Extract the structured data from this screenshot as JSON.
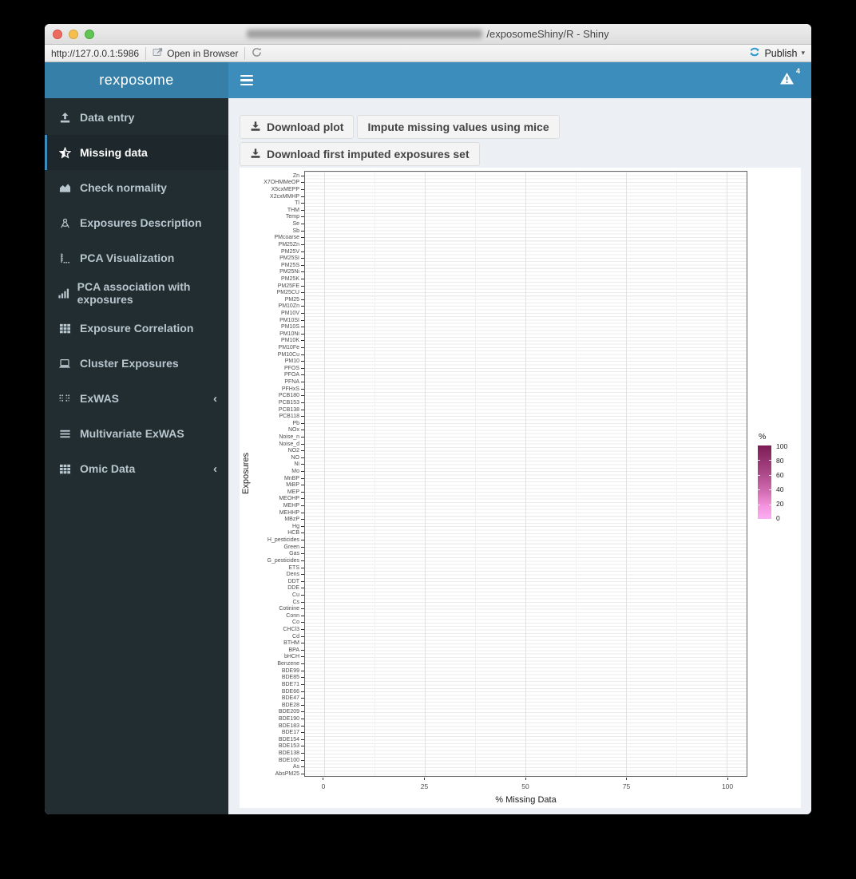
{
  "window": {
    "title_suffix": "/exposomeShiny/R - Shiny",
    "traffic_lights": [
      "close",
      "minimize",
      "zoom"
    ]
  },
  "browser_bar": {
    "url": "http://127.0.0.1:5986",
    "open_in_browser_label": "Open in Browser",
    "open_in_browser_icon": "open-in-browser-icon",
    "refresh_icon": "refresh-icon",
    "publish_label": "Publish",
    "publish_icon": "publish-icon",
    "publish_caret": "▾",
    "accent_color": "#2798d2"
  },
  "header": {
    "logo": "rexposome",
    "logo_bg": "#367fa9",
    "navbar_bg": "#3c8dbc",
    "menu_icon": "hamburger-icon",
    "alert_icon": "warning-triangle-icon",
    "alert_count": "4"
  },
  "sidebar": {
    "bg": "#222d32",
    "active_bg": "#1e282c",
    "active_border": "#3c8dbc",
    "text_color": "#b8c7ce",
    "items": [
      {
        "label": "Data entry",
        "icon": "upload-icon",
        "active": false,
        "chevron": false
      },
      {
        "label": "Missing data",
        "icon": "star-half-icon",
        "active": true,
        "chevron": false
      },
      {
        "label": "Check normality",
        "icon": "area-chart-icon",
        "active": false,
        "chevron": false
      },
      {
        "label": "Exposures Description",
        "icon": "drafting-compass-icon",
        "active": false,
        "chevron": false
      },
      {
        "label": "PCA Visualization",
        "icon": "ruler-chart-icon",
        "active": false,
        "chevron": false
      },
      {
        "label": "PCA association with exposures",
        "icon": "bar-chart-icon",
        "active": false,
        "chevron": false
      },
      {
        "label": "Exposure Correlation",
        "icon": "grid-icon",
        "active": false,
        "chevron": false
      },
      {
        "label": "Cluster Exposures",
        "icon": "laptop-icon",
        "active": false,
        "chevron": false
      },
      {
        "label": "ExWAS",
        "icon": "braille-icon",
        "active": false,
        "chevron": true
      },
      {
        "label": "Multivariate ExWAS",
        "icon": "list-lines-icon",
        "active": false,
        "chevron": false
      },
      {
        "label": "Omic Data",
        "icon": "grid-icon",
        "active": false,
        "chevron": true
      }
    ]
  },
  "toolbar": {
    "download_plot_label": "Download plot",
    "download_plot_icon": "download-icon",
    "impute_label": "Impute missing values using mice",
    "download_imputed_label": "Download first imputed exposures set",
    "download_imputed_icon": "download-icon"
  },
  "chart_data": {
    "type": "bar",
    "orientation": "horizontal",
    "title": "",
    "xlabel": "% Missing Data",
    "ylabel": "Exposures",
    "xlim": [
      0,
      100
    ],
    "x_ticks": [
      0,
      25,
      50,
      75,
      100
    ],
    "x_minor_ticks": [
      12.5,
      37.5,
      62.5,
      87.5
    ],
    "grid": true,
    "categories": [
      "Zn",
      "X7OHMMeOP",
      "X5cxMEPP",
      "X2cxMMHP",
      "Tl",
      "THM",
      "Temp",
      "Se",
      "Sb",
      "PMcoarse",
      "PM25Zn",
      "PM25V",
      "PM25SI",
      "PM25S",
      "PM25Ni",
      "PM25K",
      "PM25FE",
      "PM25CU",
      "PM25",
      "PM10Zn",
      "PM10V",
      "PM10SI",
      "PM10S",
      "PM10Ni",
      "PM10K",
      "PM10Fe",
      "PM10Cu",
      "PM10",
      "PFOS",
      "PFOA",
      "PFNA",
      "PFHxS",
      "PCB180",
      "PCB153",
      "PCB138",
      "PCB118",
      "Pb",
      "NOx",
      "Noise_n",
      "Noise_d",
      "NO2",
      "NO",
      "Ni",
      "Mo",
      "MnBP",
      "MiBP",
      "MEP",
      "MEOHP",
      "MEHP",
      "MEHHP",
      "MBzP",
      "Hg",
      "HCB",
      "H_pesticides",
      "Green",
      "Gas",
      "G_pesticides",
      "ETS",
      "Dens",
      "DDT",
      "DDE",
      "Cu",
      "Cs",
      "Cotinine",
      "Conn",
      "Co",
      "CHCl3",
      "Cd",
      "BTHM",
      "BPA",
      "bHCH",
      "Benzene",
      "BDE99",
      "BDE85",
      "BDE71",
      "BDE66",
      "BDE47",
      "BDE28",
      "BDE209",
      "BDE190",
      "BDE183",
      "BDE17",
      "BDE154",
      "BDE153",
      "BDE138",
      "BDE100",
      "As",
      "AbsPM25"
    ],
    "values": [
      0,
      0,
      0,
      0,
      0,
      0,
      0,
      0,
      0,
      0,
      0,
      0,
      0,
      0,
      0,
      0,
      0,
      0,
      0,
      0,
      0,
      0,
      0,
      0,
      0,
      0,
      0,
      0,
      0,
      0,
      0,
      0,
      0,
      0,
      0,
      0,
      0,
      0,
      0,
      0,
      0,
      0,
      0,
      0,
      0,
      0,
      0,
      0,
      0,
      0,
      0,
      0,
      0,
      0,
      0,
      0,
      0,
      0,
      0,
      0,
      0,
      0,
      0,
      0,
      0,
      0,
      0,
      0,
      0,
      0,
      0,
      0,
      0,
      0,
      0,
      0,
      0,
      0,
      0,
      0,
      0,
      0,
      0,
      0,
      0,
      0,
      0,
      0
    ],
    "bar_color": "#fcaff2",
    "legend": {
      "title": "%",
      "position": "right",
      "tick_labels": [
        "100",
        "80",
        "60",
        "40",
        "20",
        "0"
      ],
      "gradient_top_color": "#7b1d55",
      "gradient_bottom_color": "#fcaff2"
    }
  }
}
